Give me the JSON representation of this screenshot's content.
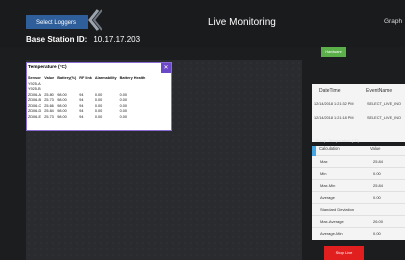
{
  "colors": {
    "accent": "#2f5f9a",
    "hardware_green": "#5bb04a",
    "stop_red": "#e11f1f",
    "card_border": "#8a6bd1"
  },
  "toolbar": {
    "select_loggers_label": "Select Loggers",
    "title": "Live Monitoring",
    "graph_tab_label": "Graph"
  },
  "base_station": {
    "label": "Base Station ID:",
    "value": "10.17.17.203"
  },
  "sensor_table": {
    "title": "Temperature (°C)",
    "columns": [
      "Sensor",
      "Value",
      "Battery(%)",
      "RF link",
      "Alarmability",
      "Battery Health"
    ],
    "rows": [
      [
        "Y925-A",
        "",
        "",
        "",
        "",
        ""
      ],
      [
        "Y925-B",
        "",
        "",
        "",
        "",
        ""
      ],
      [
        "ZD06-A",
        "25.80",
        "98.00",
        "94",
        "0.00",
        "0.00"
      ],
      [
        "ZD06-B",
        "25.73",
        "98.00",
        "94",
        "0.00",
        "0.00"
      ],
      [
        "ZD06-C",
        "25.66",
        "98.00",
        "94",
        "0.00",
        "0.00"
      ],
      [
        "ZD06-D",
        "25.84",
        "98.00",
        "94",
        "0.00",
        "0.00"
      ],
      [
        "ZD06-E",
        "25.73",
        "98.00",
        "94",
        "0.00",
        "0.00"
      ]
    ]
  },
  "hardware_button_label": "Hardware",
  "events": {
    "columns": [
      "DateTime",
      "EventName"
    ],
    "rows": [
      [
        "12/14/2018 1:21:32 PM",
        "SELECT_LIVE_INO"
      ],
      [
        "12/14/2018 1:21:18 PM",
        "SELECT_LIVE_INO"
      ]
    ]
  },
  "stats": {
    "group_label": "Group: Temperature (°C)",
    "columns": [
      "Calculation",
      "Value"
    ],
    "rows": [
      [
        "Max",
        "25.84"
      ],
      [
        "Min",
        "0.00"
      ],
      [
        "Max-Min",
        "25.84"
      ],
      [
        "Average",
        "0.00"
      ],
      [
        "Standard Deviation",
        ""
      ],
      [
        "Max-Average",
        "26.00"
      ],
      [
        "Average-Min",
        "0.00"
      ]
    ]
  },
  "stop_button_label": "Stop Live"
}
